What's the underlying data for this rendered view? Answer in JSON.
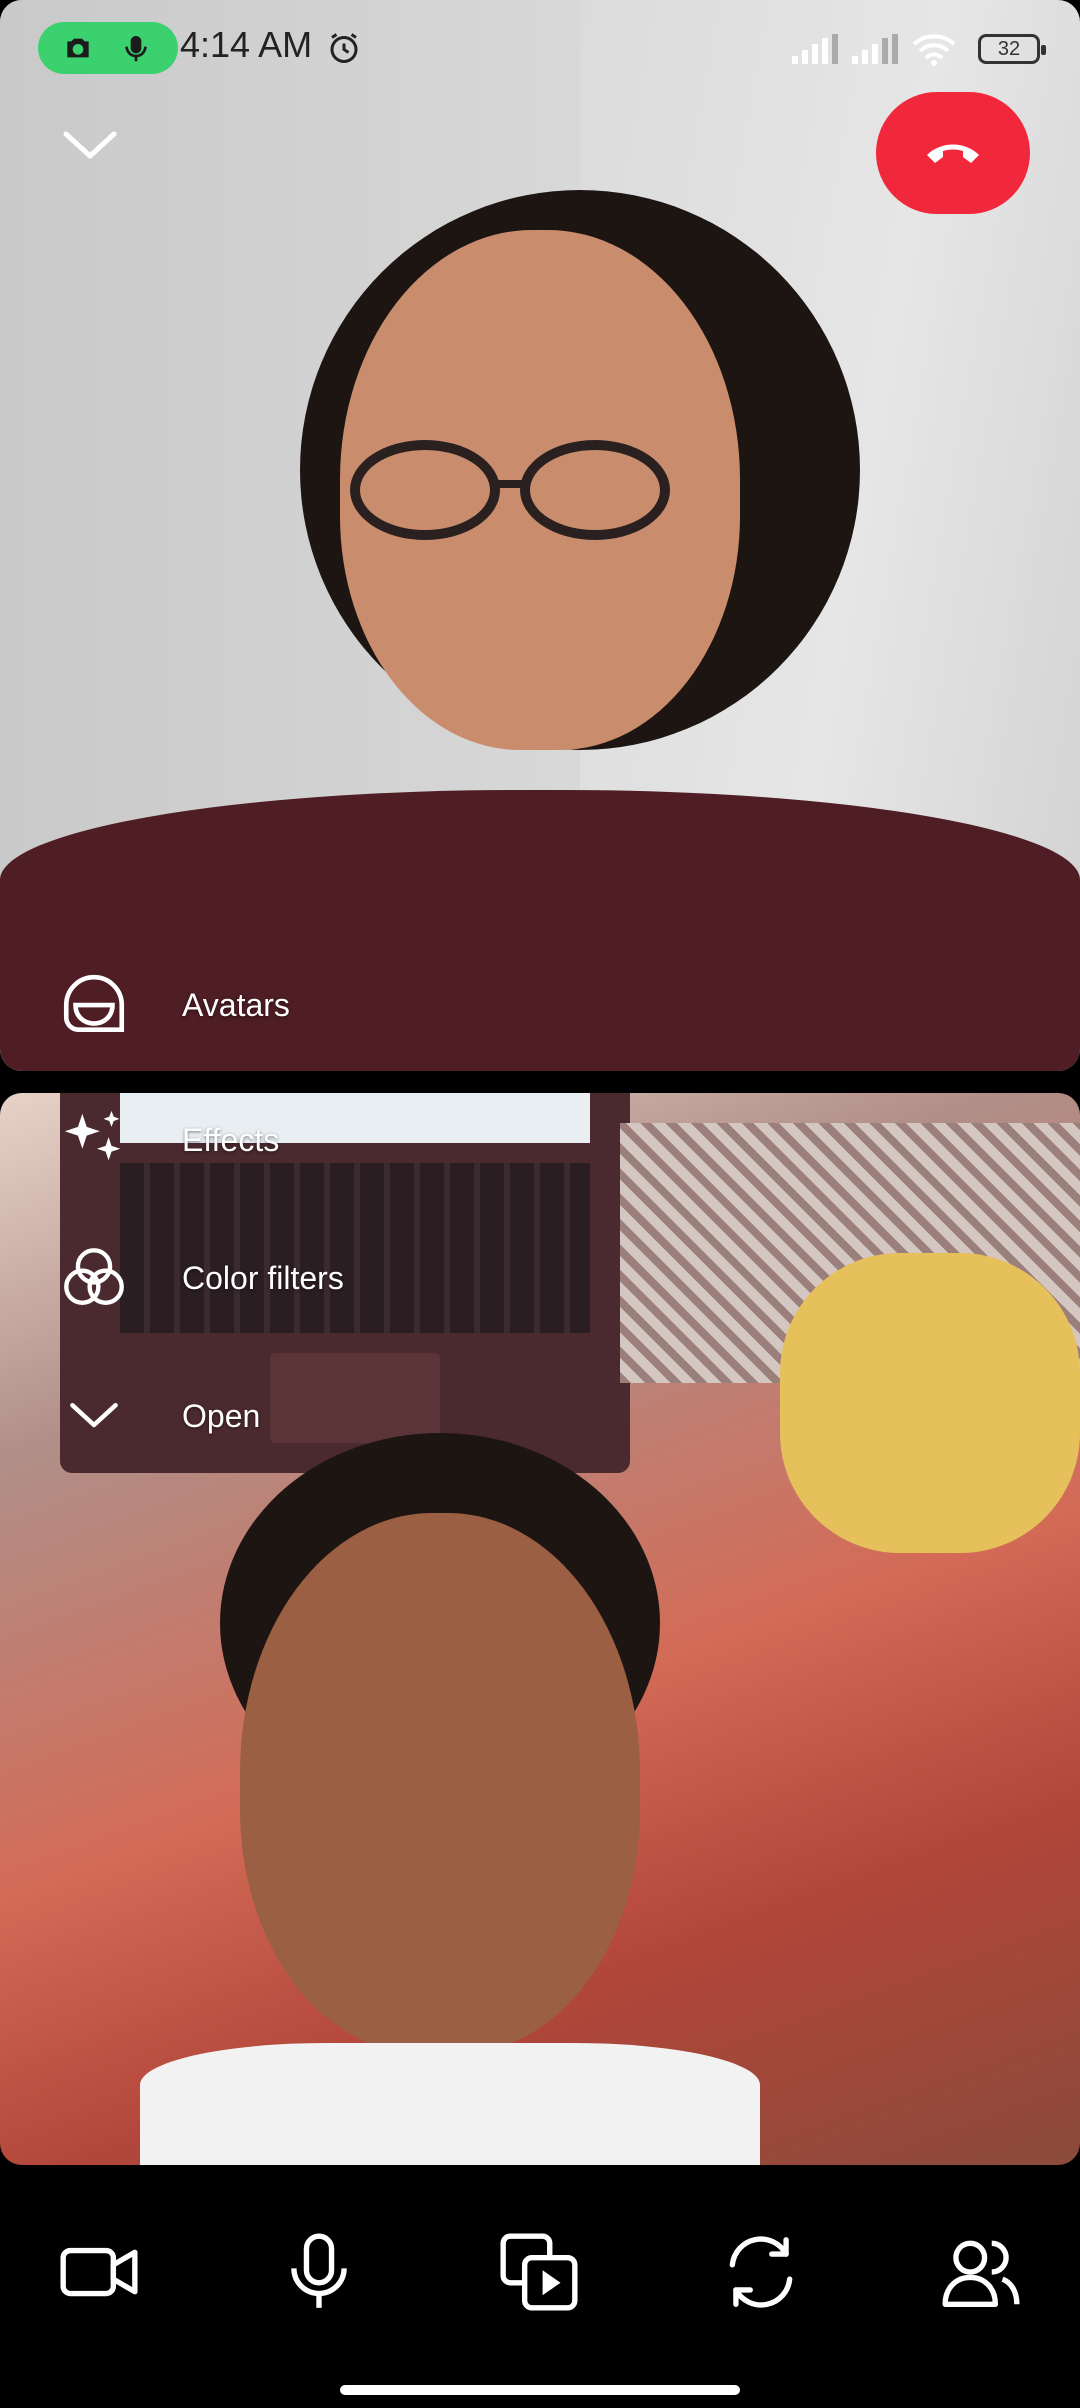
{
  "status_bar": {
    "time": "4:14 AM",
    "battery": "32",
    "recording_indicator_color": "#3bd16f"
  },
  "call": {
    "end_call_color": "#f1273c",
    "remote_tile": {
      "menu": [
        {
          "label": "Avatars",
          "icon": "avatar-mask-icon"
        }
      ]
    },
    "self_tile": {
      "menu": [
        {
          "label": "Effects",
          "icon": "sparkles-icon"
        },
        {
          "label": "Color filters",
          "icon": "color-filters-icon"
        },
        {
          "label": "Open",
          "icon": "chevron-down-icon"
        }
      ]
    }
  },
  "controls": [
    {
      "name": "camera-toggle",
      "icon": "video-camera-icon"
    },
    {
      "name": "microphone-toggle",
      "icon": "microphone-icon"
    },
    {
      "name": "share-media",
      "icon": "media-share-icon"
    },
    {
      "name": "flip-camera",
      "icon": "flip-camera-icon"
    },
    {
      "name": "participants",
      "icon": "people-icon"
    }
  ]
}
